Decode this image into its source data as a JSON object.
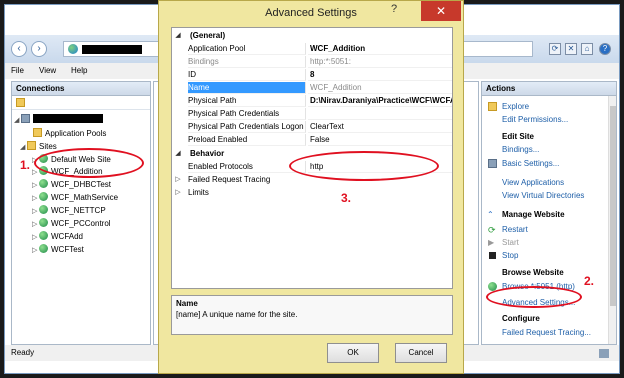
{
  "dialog": {
    "title": "Advanced Settings",
    "help": "?",
    "close": "✕",
    "categories": {
      "general": "(General)",
      "behavior": "Behavior"
    },
    "general_rows": [
      {
        "key": "Application Pool",
        "value": "WCF_Addition"
      },
      {
        "key": "Bindings",
        "value": "http:*:5051:"
      },
      {
        "key": "ID",
        "value": "8"
      },
      {
        "key": "Name",
        "value": "WCF_Addition"
      },
      {
        "key": "Physical Path",
        "value": "D:\\Nirav.Daraniya\\Practice\\WCF\\WCFA"
      },
      {
        "key": "Physical Path Credentials",
        "value": ""
      },
      {
        "key": "Physical Path Credentials Logon",
        "value": "ClearText"
      },
      {
        "key": "Preload Enabled",
        "value": "False"
      }
    ],
    "behavior_rows": [
      {
        "key": "Enabled Protocols",
        "value": "http"
      },
      {
        "key": "Failed Request Tracing",
        "value": ""
      },
      {
        "key": "Limits",
        "value": ""
      }
    ],
    "description": {
      "name": "Name",
      "text": "[name] A unique name for the site."
    },
    "ok_label": "OK",
    "cancel_label": "Cancel"
  },
  "iis": {
    "menu": [
      "File",
      "View",
      "Help"
    ],
    "connections_title": "Connections",
    "tree": {
      "app_pools": "Application Pools",
      "sites": "Sites",
      "site_items": [
        "Default Web Site",
        "WCF_Addition",
        "WCF_DHBCTest",
        "WCF_MathService",
        "WCF_NETTCP",
        "WCF_PCControl",
        "WCFAdd",
        "WCFTest"
      ]
    },
    "actions_title": "Actions",
    "actions": {
      "explore": "Explore",
      "edit_permissions": "Edit Permissions...",
      "edit_site": "Edit Site",
      "bindings": "Bindings...",
      "basic_settings": "Basic Settings...",
      "view_applications": "View Applications",
      "view_virtual_directories": "View Virtual Directories",
      "manage_website": "Manage Website",
      "restart": "Restart",
      "start": "Start",
      "stop": "Stop",
      "browse_website": "Browse Website",
      "browse_link": "Browse *:5051 (http)",
      "advanced_settings": "Advanced Settings...",
      "configure": "Configure",
      "failed_request_tracing": "Failed Request Tracing..."
    },
    "status": "Ready"
  },
  "annotations": [
    "1.",
    "2.",
    "3."
  ],
  "colors": {
    "dialog_bg": "#f0e7a0",
    "selection": "#3399ff",
    "annotation": "#e01020",
    "link": "#1e5fa8"
  }
}
